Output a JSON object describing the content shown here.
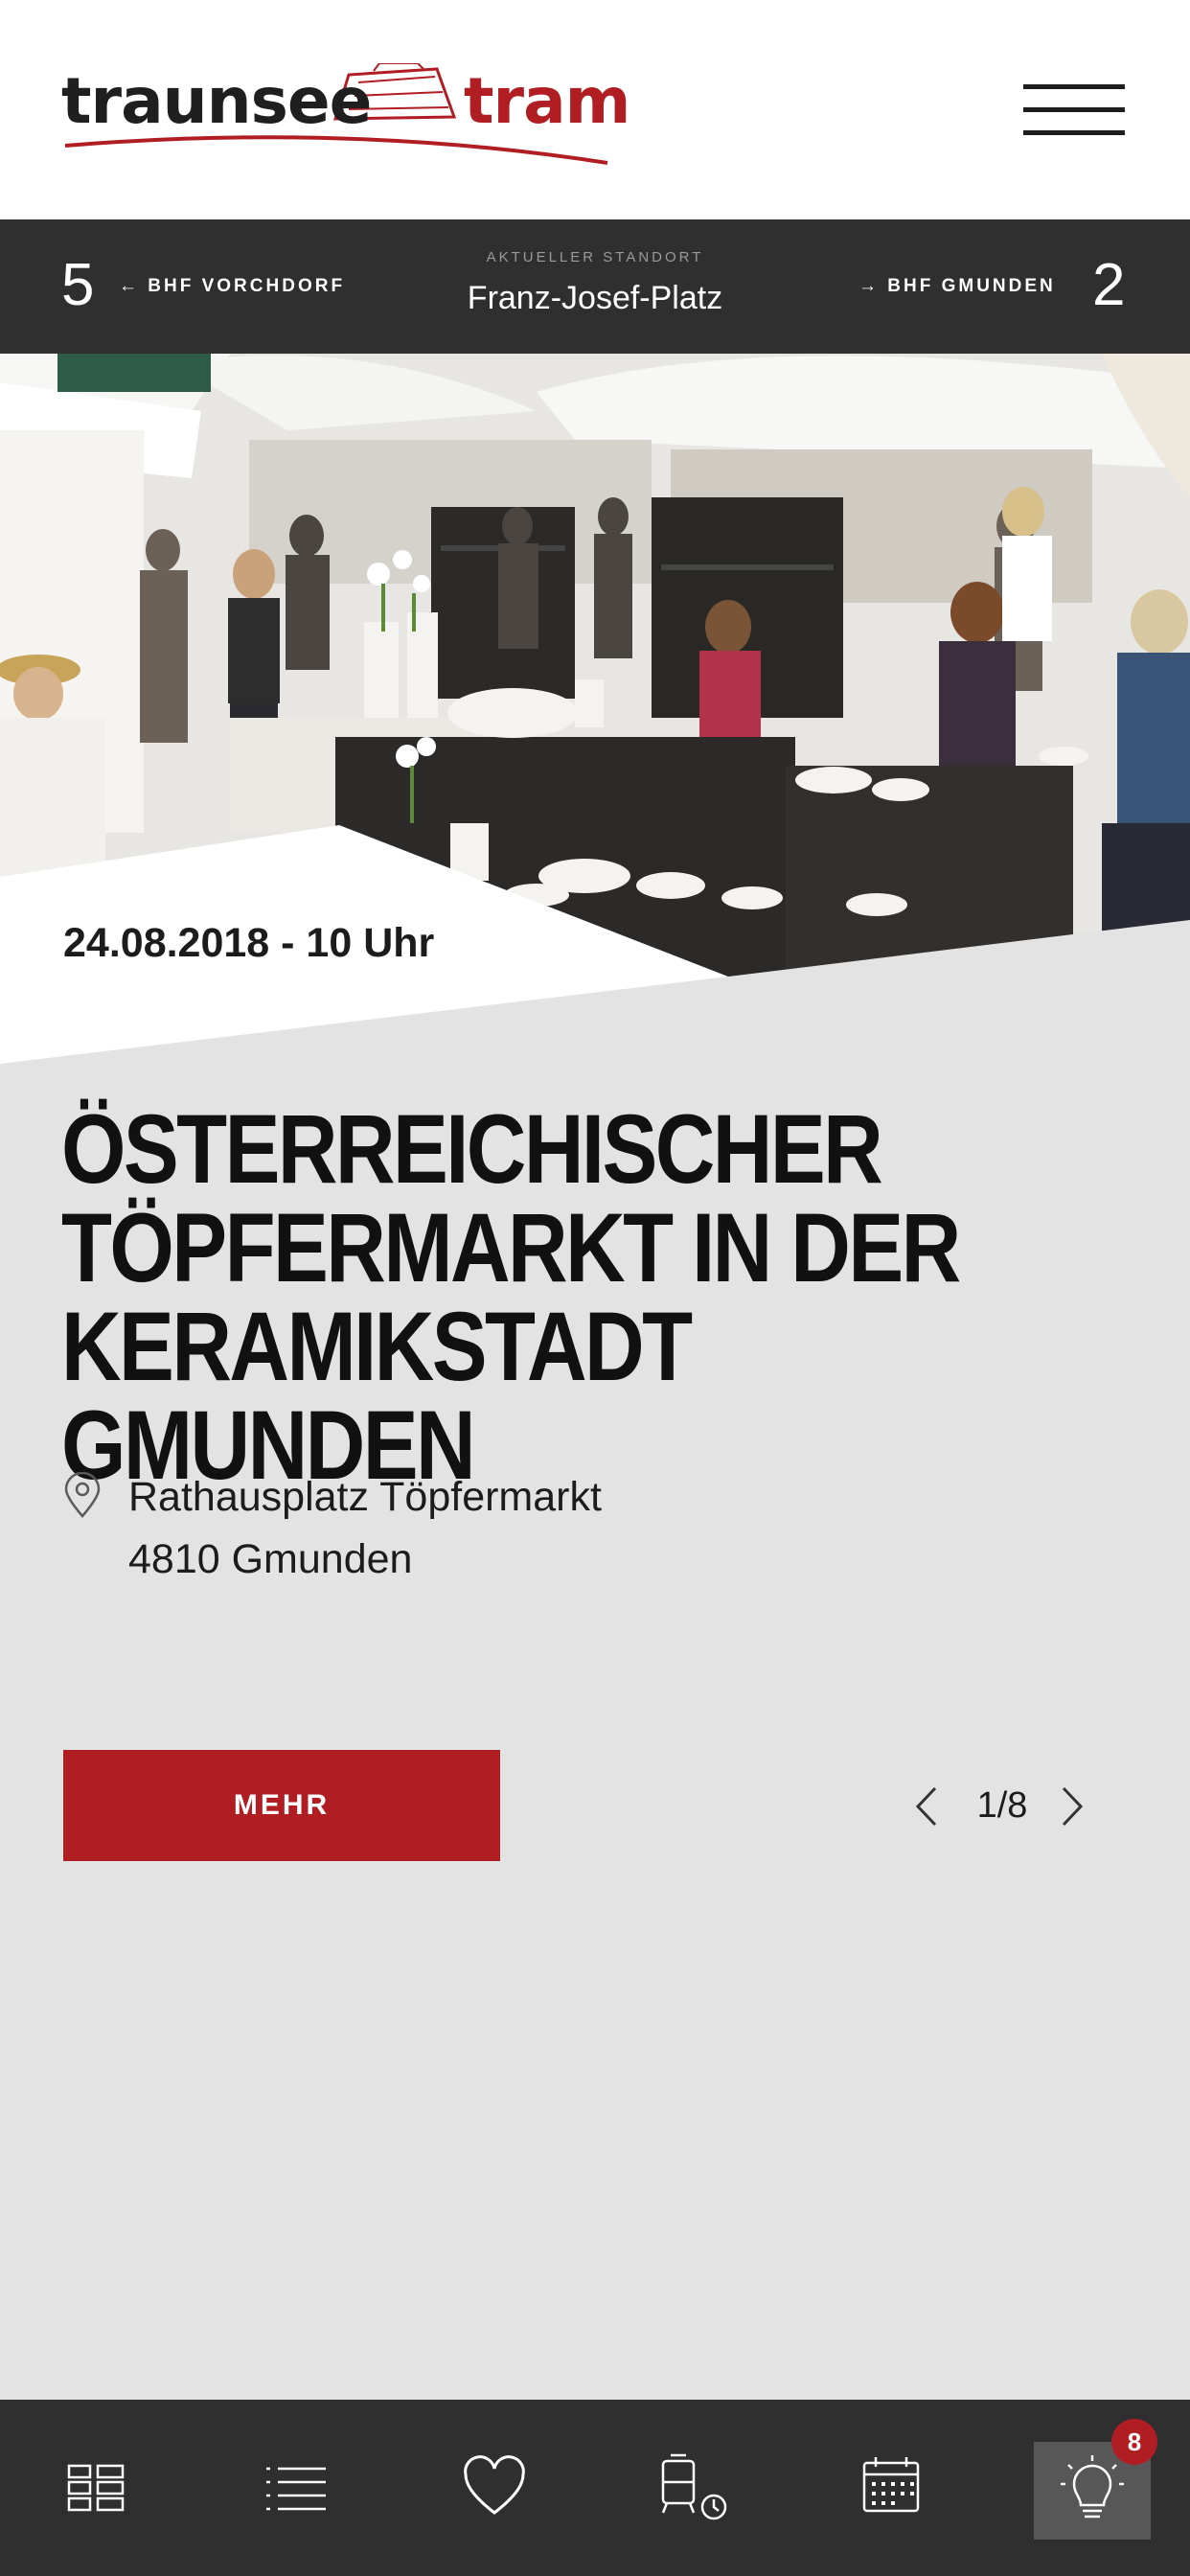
{
  "header": {
    "logo_left": "traunsee",
    "logo_right": "tram",
    "menu_icon": "hamburger-menu-icon"
  },
  "station_bar": {
    "prev_count": "5",
    "prev_label": "← BHF VORCHDORF",
    "caption": "AKTUELLER STANDORT",
    "current_station": "Franz-Josef-Platz",
    "next_label": "→ BHF GMUNDEN",
    "next_count": "2"
  },
  "event": {
    "date": "24.08.2018 - 10 Uhr",
    "title": "ÖSTERREICHISCHER TÖPFERMARKT IN DER KERAMIKSTADT GMUNDEN",
    "address_line1": "Rathausplatz Töpfermarkt",
    "address_line2": "4810 Gmunden",
    "more_label": "MEHR"
  },
  "pager": {
    "text": "1/8",
    "current": 1,
    "total": 8
  },
  "bottom_nav": {
    "items": [
      {
        "icon": "grid-icon"
      },
      {
        "icon": "list-icon"
      },
      {
        "icon": "heart-icon"
      },
      {
        "icon": "tram-timetable-icon"
      },
      {
        "icon": "calendar-icon"
      },
      {
        "icon": "lightbulb-icon"
      }
    ],
    "badge": "8"
  },
  "colors": {
    "brand_red": "#b01e23",
    "dark_bar": "#2f2f2f",
    "page_bg": "#e3e3e3"
  }
}
